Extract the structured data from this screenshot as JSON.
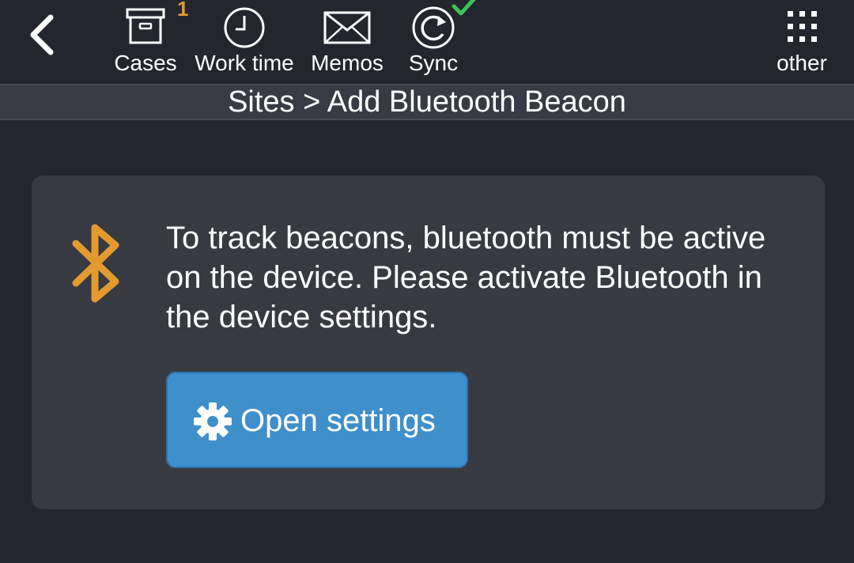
{
  "header": {
    "nav_items": [
      {
        "label": "Cases",
        "icon": "archive-box-icon",
        "badge": "1"
      },
      {
        "label": "Work time",
        "icon": "clock-icon"
      },
      {
        "label": "Memos",
        "icon": "envelope-icon"
      },
      {
        "label": "Sync",
        "icon": "sync-icon",
        "status": "check-icon"
      }
    ],
    "other": {
      "label": "other",
      "icon": "grid-icon"
    }
  },
  "breadcrumb": "Sites > Add Bluetooth Beacon",
  "card": {
    "icon": "bluetooth-icon",
    "message": "To track beacons, bluetooth must be active on the device. Please activate Bluetooth in the device settings.",
    "button_label": "Open settings",
    "button_icon": "gear-icon"
  },
  "colors": {
    "background": "#23262d",
    "card": "#383a41",
    "accent_orange": "#e39a2f",
    "button_blue": "#3f8fcb",
    "success_green": "#3cc35a"
  }
}
